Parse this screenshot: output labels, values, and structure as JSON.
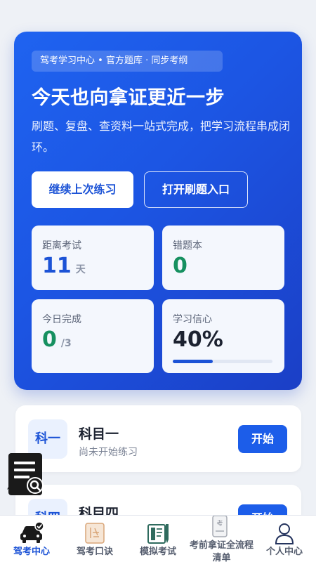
{
  "hero": {
    "chip": "驾考学习中心 • 官方题库 · 同步考纲",
    "title": "今天也向拿证更近一步",
    "subtitle": "刷题、复盘、查资料一站式完成，把学习流程串成闭环。",
    "primary_button": "继续上次练习",
    "secondary_button": "打开刷题入口"
  },
  "stats": {
    "days_to_exam": {
      "label": "距离考试",
      "value": "11",
      "unit": "天"
    },
    "wrong_book": {
      "label": "错题本",
      "value": "0"
    },
    "today_done": {
      "label": "今日完成",
      "value": "0",
      "unit": "/3"
    },
    "confidence": {
      "label": "学习信心",
      "value": "40%",
      "progress": 0.4
    }
  },
  "subjects": [
    {
      "badge": "科一",
      "name": "科目一",
      "status": "尚未开始练习",
      "action": "开始"
    },
    {
      "badge": "科四",
      "name": "科目四",
      "status": "",
      "action": "开始"
    }
  ],
  "tabbar": {
    "items": [
      {
        "label": "驾考中心",
        "icon": "car-check-icon",
        "active": true
      },
      {
        "label": "驾考口诀",
        "icon": "notebook-icon",
        "active": false
      },
      {
        "label": "模拟考试",
        "icon": "book-pen-icon",
        "active": false
      },
      {
        "label": "考前拿证全流程清单",
        "icon": "phone-exam-icon",
        "active": false
      },
      {
        "label": "个人中心",
        "icon": "person-icon",
        "active": false
      }
    ]
  },
  "colors": {
    "accent": "#1c53d6",
    "hero_start": "#1f63f0",
    "hero_end": "#1b3fc6",
    "success": "#169060"
  }
}
